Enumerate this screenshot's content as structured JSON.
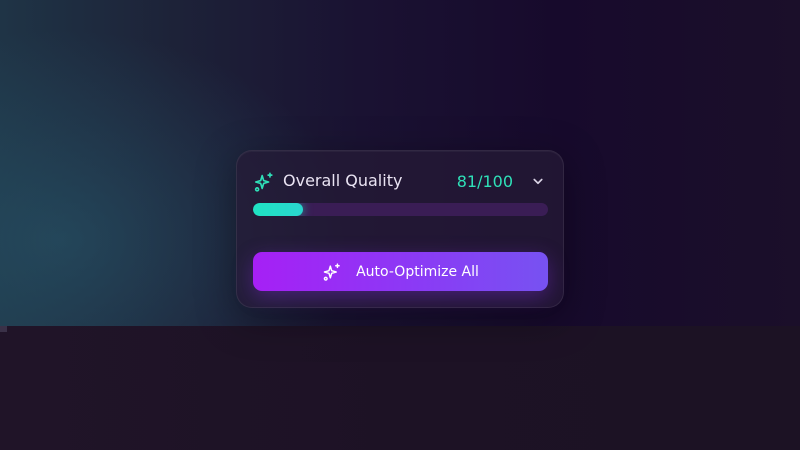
{
  "quality_panel": {
    "title": "Overall Quality",
    "score_text": "81/100",
    "progress_fraction": 0.17,
    "accent_color": "#2fe0b8",
    "icon": "sparkle-icon",
    "toggle_icon": "chevron-down-icon"
  },
  "optimize_button": {
    "label": "Auto-Optimize All",
    "icon": "sparkle-icon",
    "gradient_colors": [
      "#a620f5",
      "#7752f2"
    ]
  }
}
